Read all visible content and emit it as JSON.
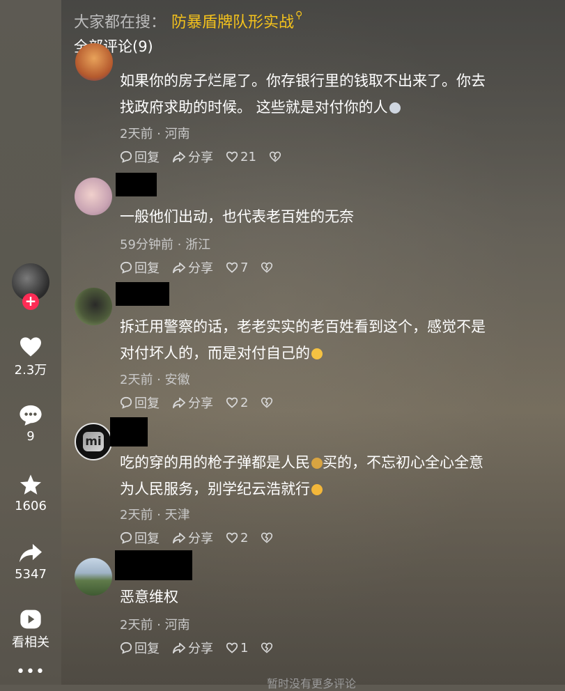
{
  "search": {
    "prefix": "大家都在搜：",
    "keyword": "防暴盾牌队形实战"
  },
  "comments_title": "全部评论(9)",
  "sidebar": {
    "likes": "2.3万",
    "comments": "9",
    "favorites": "1606",
    "shares": "5347",
    "related": "看相关"
  },
  "comments": [
    {
      "text1": "如果你的房子烂尾了。你存银行里的钱取不出来了。你去",
      "text2": "找政府求助的时候。 这些就是对付你的人",
      "time": "2天前",
      "location": "河南",
      "reply": "回复",
      "share": "分享",
      "likes": "21"
    },
    {
      "text1": "一般他们出动，也代表老百姓的无奈",
      "time": "59分钟前",
      "location": "浙江",
      "reply": "回复",
      "share": "分享",
      "likes": "7"
    },
    {
      "text1": "拆迁用警察的话，老老实实的老百姓看到这个，感觉不是",
      "text2": "对付坏人的，而是对付自己的",
      "time": "2天前",
      "location": "安徽",
      "reply": "回复",
      "share": "分享",
      "likes": "2"
    },
    {
      "text1a": "吃的穿的用的枪子弹都是人民",
      "text1b": "买的，不忘初心全心全意",
      "text2": "为人民服务，别学纪云浩就行",
      "time": "2天前",
      "location": "天津",
      "reply": "回复",
      "share": "分享",
      "likes": "2"
    },
    {
      "text1": "恶意维权",
      "time": "2天前",
      "location": "河南",
      "reply": "回复",
      "share": "分享",
      "likes": "1"
    }
  ],
  "footer": "暂时没有更多评论",
  "colors": {
    "accent": "#f4c21c",
    "follow": "#fe2c55"
  }
}
